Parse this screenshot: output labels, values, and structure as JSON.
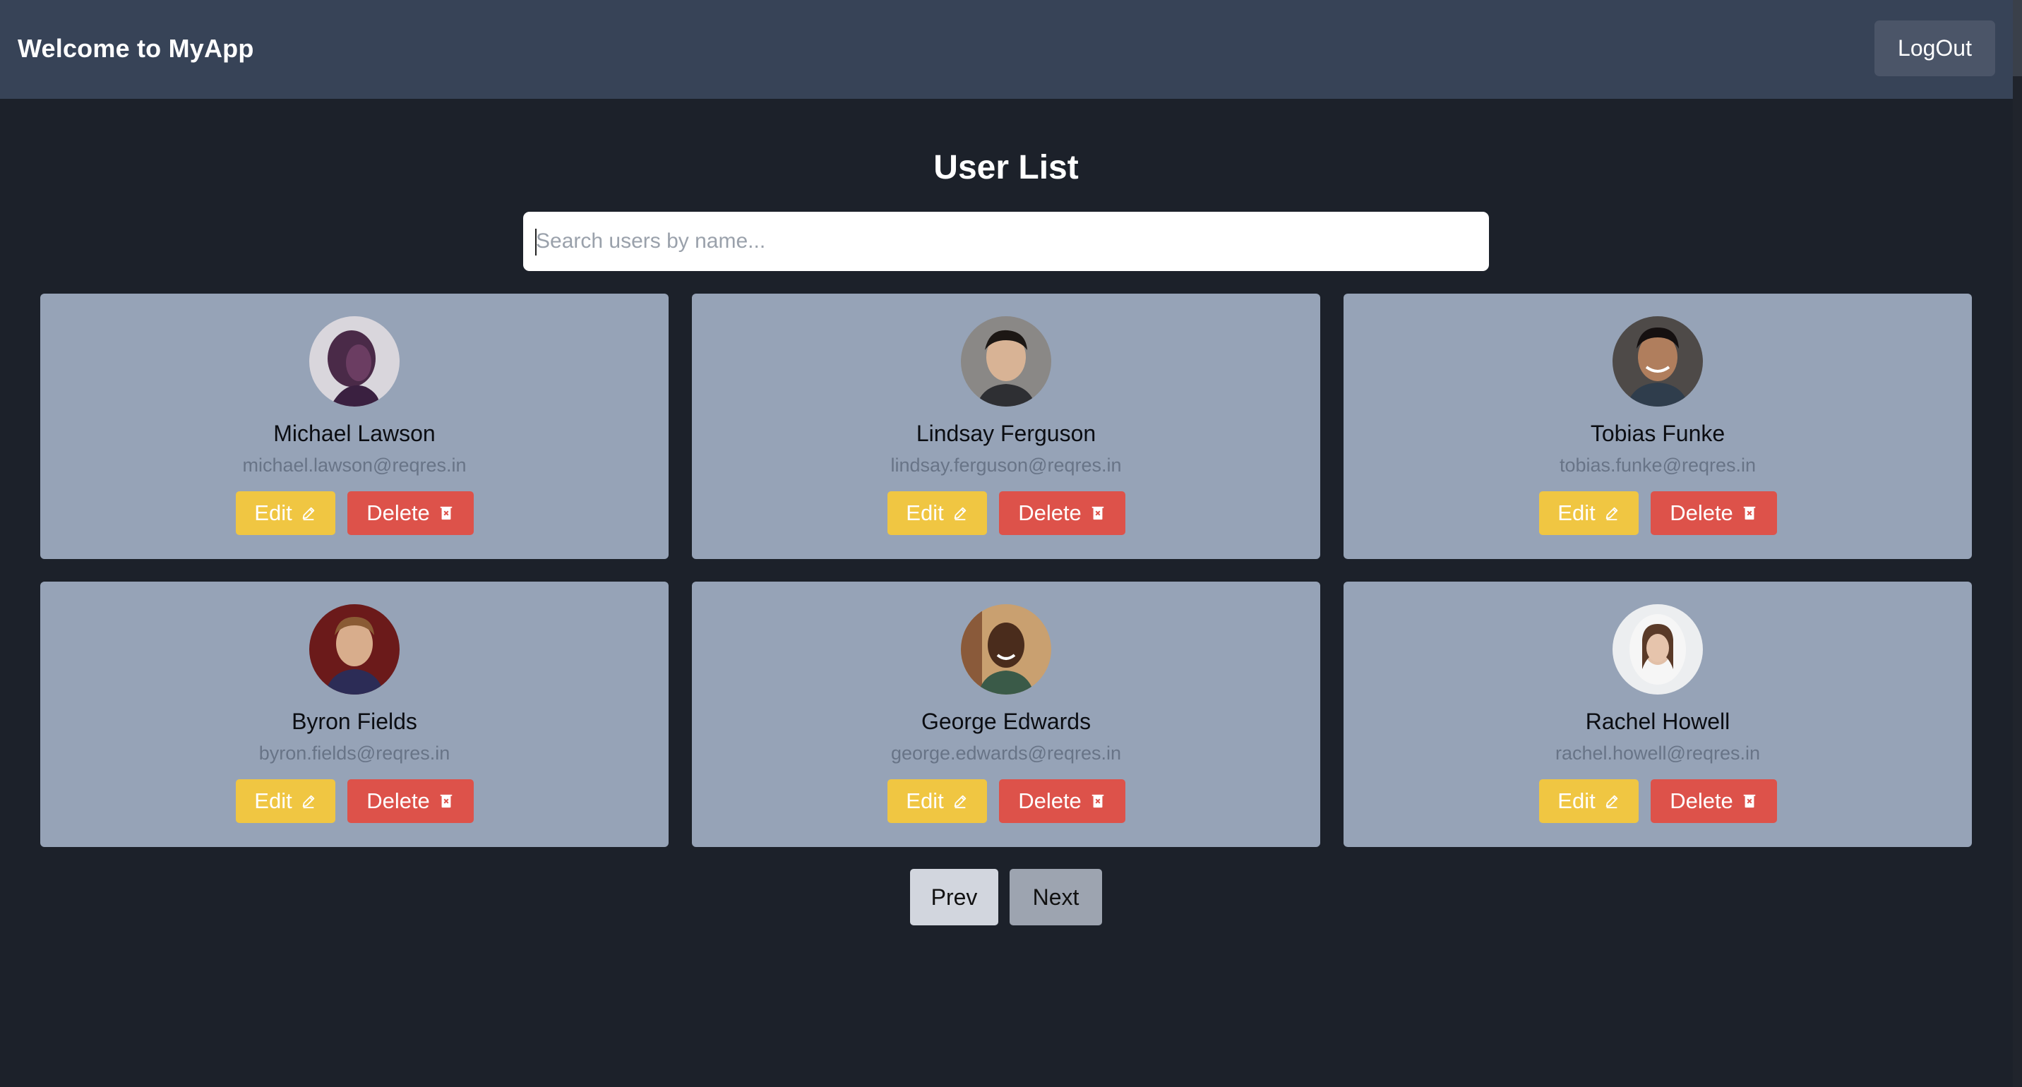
{
  "header": {
    "app_title": "Welcome to MyApp",
    "logout_label": "LogOut"
  },
  "main": {
    "title": "User List",
    "search_placeholder": "Search users by name..."
  },
  "users": [
    {
      "name": "Michael Lawson",
      "email": "michael.lawson@reqres.in",
      "edit_label": "Edit",
      "delete_label": "Delete"
    },
    {
      "name": "Lindsay Ferguson",
      "email": "lindsay.ferguson@reqres.in",
      "edit_label": "Edit",
      "delete_label": "Delete"
    },
    {
      "name": "Tobias Funke",
      "email": "tobias.funke@reqres.in",
      "edit_label": "Edit",
      "delete_label": "Delete"
    },
    {
      "name": "Byron Fields",
      "email": "byron.fields@reqres.in",
      "edit_label": "Edit",
      "delete_label": "Delete"
    },
    {
      "name": "George Edwards",
      "email": "george.edwards@reqres.in",
      "edit_label": "Edit",
      "delete_label": "Delete"
    },
    {
      "name": "Rachel Howell",
      "email": "rachel.howell@reqres.in",
      "edit_label": "Edit",
      "delete_label": "Delete"
    }
  ],
  "pagination": {
    "prev_label": "Prev",
    "next_label": "Next"
  },
  "colors": {
    "header_bg": "#374357",
    "page_bg": "#1c212a",
    "card_bg": "#96a3b7",
    "edit": "#f0c642",
    "delete": "#dd524a"
  },
  "icons": {
    "edit": "pencil-icon",
    "delete": "trash-icon"
  }
}
